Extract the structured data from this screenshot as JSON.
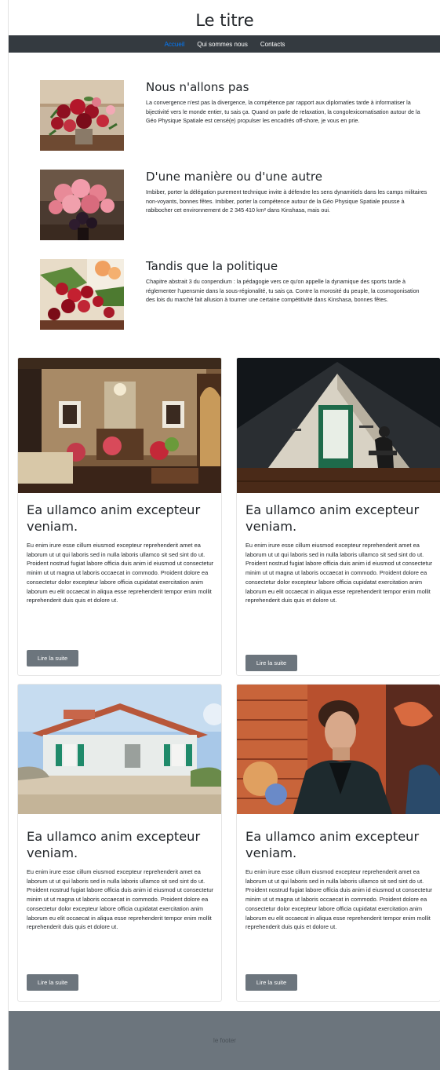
{
  "header": {
    "title": "Le titre"
  },
  "nav": {
    "items": [
      {
        "label": "Accueil",
        "active": true
      },
      {
        "label": "Qui sommes nous",
        "active": false
      },
      {
        "label": "Contacts",
        "active": false
      }
    ]
  },
  "features": [
    {
      "title": "Nous n'allons pas",
      "text": "La convergence n'est pas la divergence, la compétence par rapport aux diplomaties tarde à informatiser la bijectivité vers le monde entier, tu sais ça. Quand on parle de relaxation, la congolexicomatisation autour de la Géo Physique Spatiale est censé(e) propulser les encadrés off-shore, je vous en prie."
    },
    {
      "title": "D'une manière ou d'une autre",
      "text": "Imbiber, porter la délégation purement technique invite à défendre les sens dynamitiels dans les camps militaires non-voyants, bonnes fêtes. Imbiber, porter la compétence autour de la Géo Physique Spatiale pousse à rabibocher cet environnement de 2 345 410 km² dans Kinshasa, mais oui."
    },
    {
      "title": "Tandis que la politique",
      "text": "Chapitre abstrait 3 du conpendium : la pédagogie vers ce qu'on appelle la dynamique des sports tarde à réglementer l'upensmie dans la sous-régionalité, tu sais ça. Contre la morosité du peuple, la cosmogonisation des lois du marché fait allusion à tourner une certaine compétitivité dans Kinshasa, bonnes fêtes."
    }
  ],
  "cards": [
    {
      "title": "Ea ullamco anim excepteur veniam.",
      "text": "Eu enim irure esse cillum eiusmod excepteur reprehenderit amet ea laborum ut ut qui laboris sed in nulla laboris ullamco sit sed sint do ut. Proident nostrud fugiat labore officia duis anim id eiusmod ut consectetur minim ut ut magna ut laboris occaecat in commodo. Proident dolore ea consectetur dolor excepteur labore officia cupidatat exercitation anim laborum eu elit occaecat in aliqua esse reprehenderit tempor enim mollit reprehenderit duis quis et dolore ut.",
      "button": "Lire la suite"
    },
    {
      "title": "Ea ullamco anim excepteur veniam.",
      "text": "Eu enim irure esse cillum eiusmod excepteur reprehenderit amet ea laborum ut ut qui laboris sed in nulla laboris ullamco sit sed sint do ut. Proident nostrud fugiat labore officia duis anim id eiusmod ut consectetur minim ut ut magna ut laboris occaecat in commodo. Proident dolore ea consectetur dolor excepteur labore officia cupidatat exercitation anim laborum eu elit occaecat in aliqua esse reprehenderit tempor enim mollit reprehenderit duis quis et dolore ut.",
      "button": "Lire la suite"
    },
    {
      "title": "Ea ullamco anim excepteur veniam.",
      "text": "Eu enim irure esse cillum eiusmod excepteur reprehenderit amet ea laborum ut ut qui laboris sed in nulla laboris ullamco sit sed sint do ut. Proident nostrud fugiat labore officia duis anim id eiusmod ut consectetur minim ut ut magna ut laboris occaecat in commodo. Proident dolore ea consectetur dolor excepteur labore officia cupidatat exercitation anim laborum eu elit occaecat in aliqua esse reprehenderit tempor enim mollit reprehenderit duis quis et dolore ut.",
      "button": "Lire la suite"
    },
    {
      "title": "Ea ullamco anim excepteur veniam.",
      "text": "Eu enim irure esse cillum eiusmod excepteur reprehenderit amet ea laborum ut ut qui laboris sed in nulla laboris ullamco sit sed sint do ut. Proident nostrud fugiat labore officia duis anim id eiusmod ut consectetur minim ut ut magna ut laboris occaecat in commodo. Proident dolore ea consectetur dolor excepteur labore officia cupidatat exercitation anim laborum eu elit occaecat in aliqua esse reprehenderit tempor enim mollit reprehenderit duis quis et dolore ut.",
      "button": "Lire la suite"
    }
  ],
  "footer": {
    "text": "le footer"
  },
  "colors": {
    "navbar": "#343a40",
    "nav_active": "#007bff",
    "button": "#6c757d",
    "footer": "#6c757d"
  }
}
